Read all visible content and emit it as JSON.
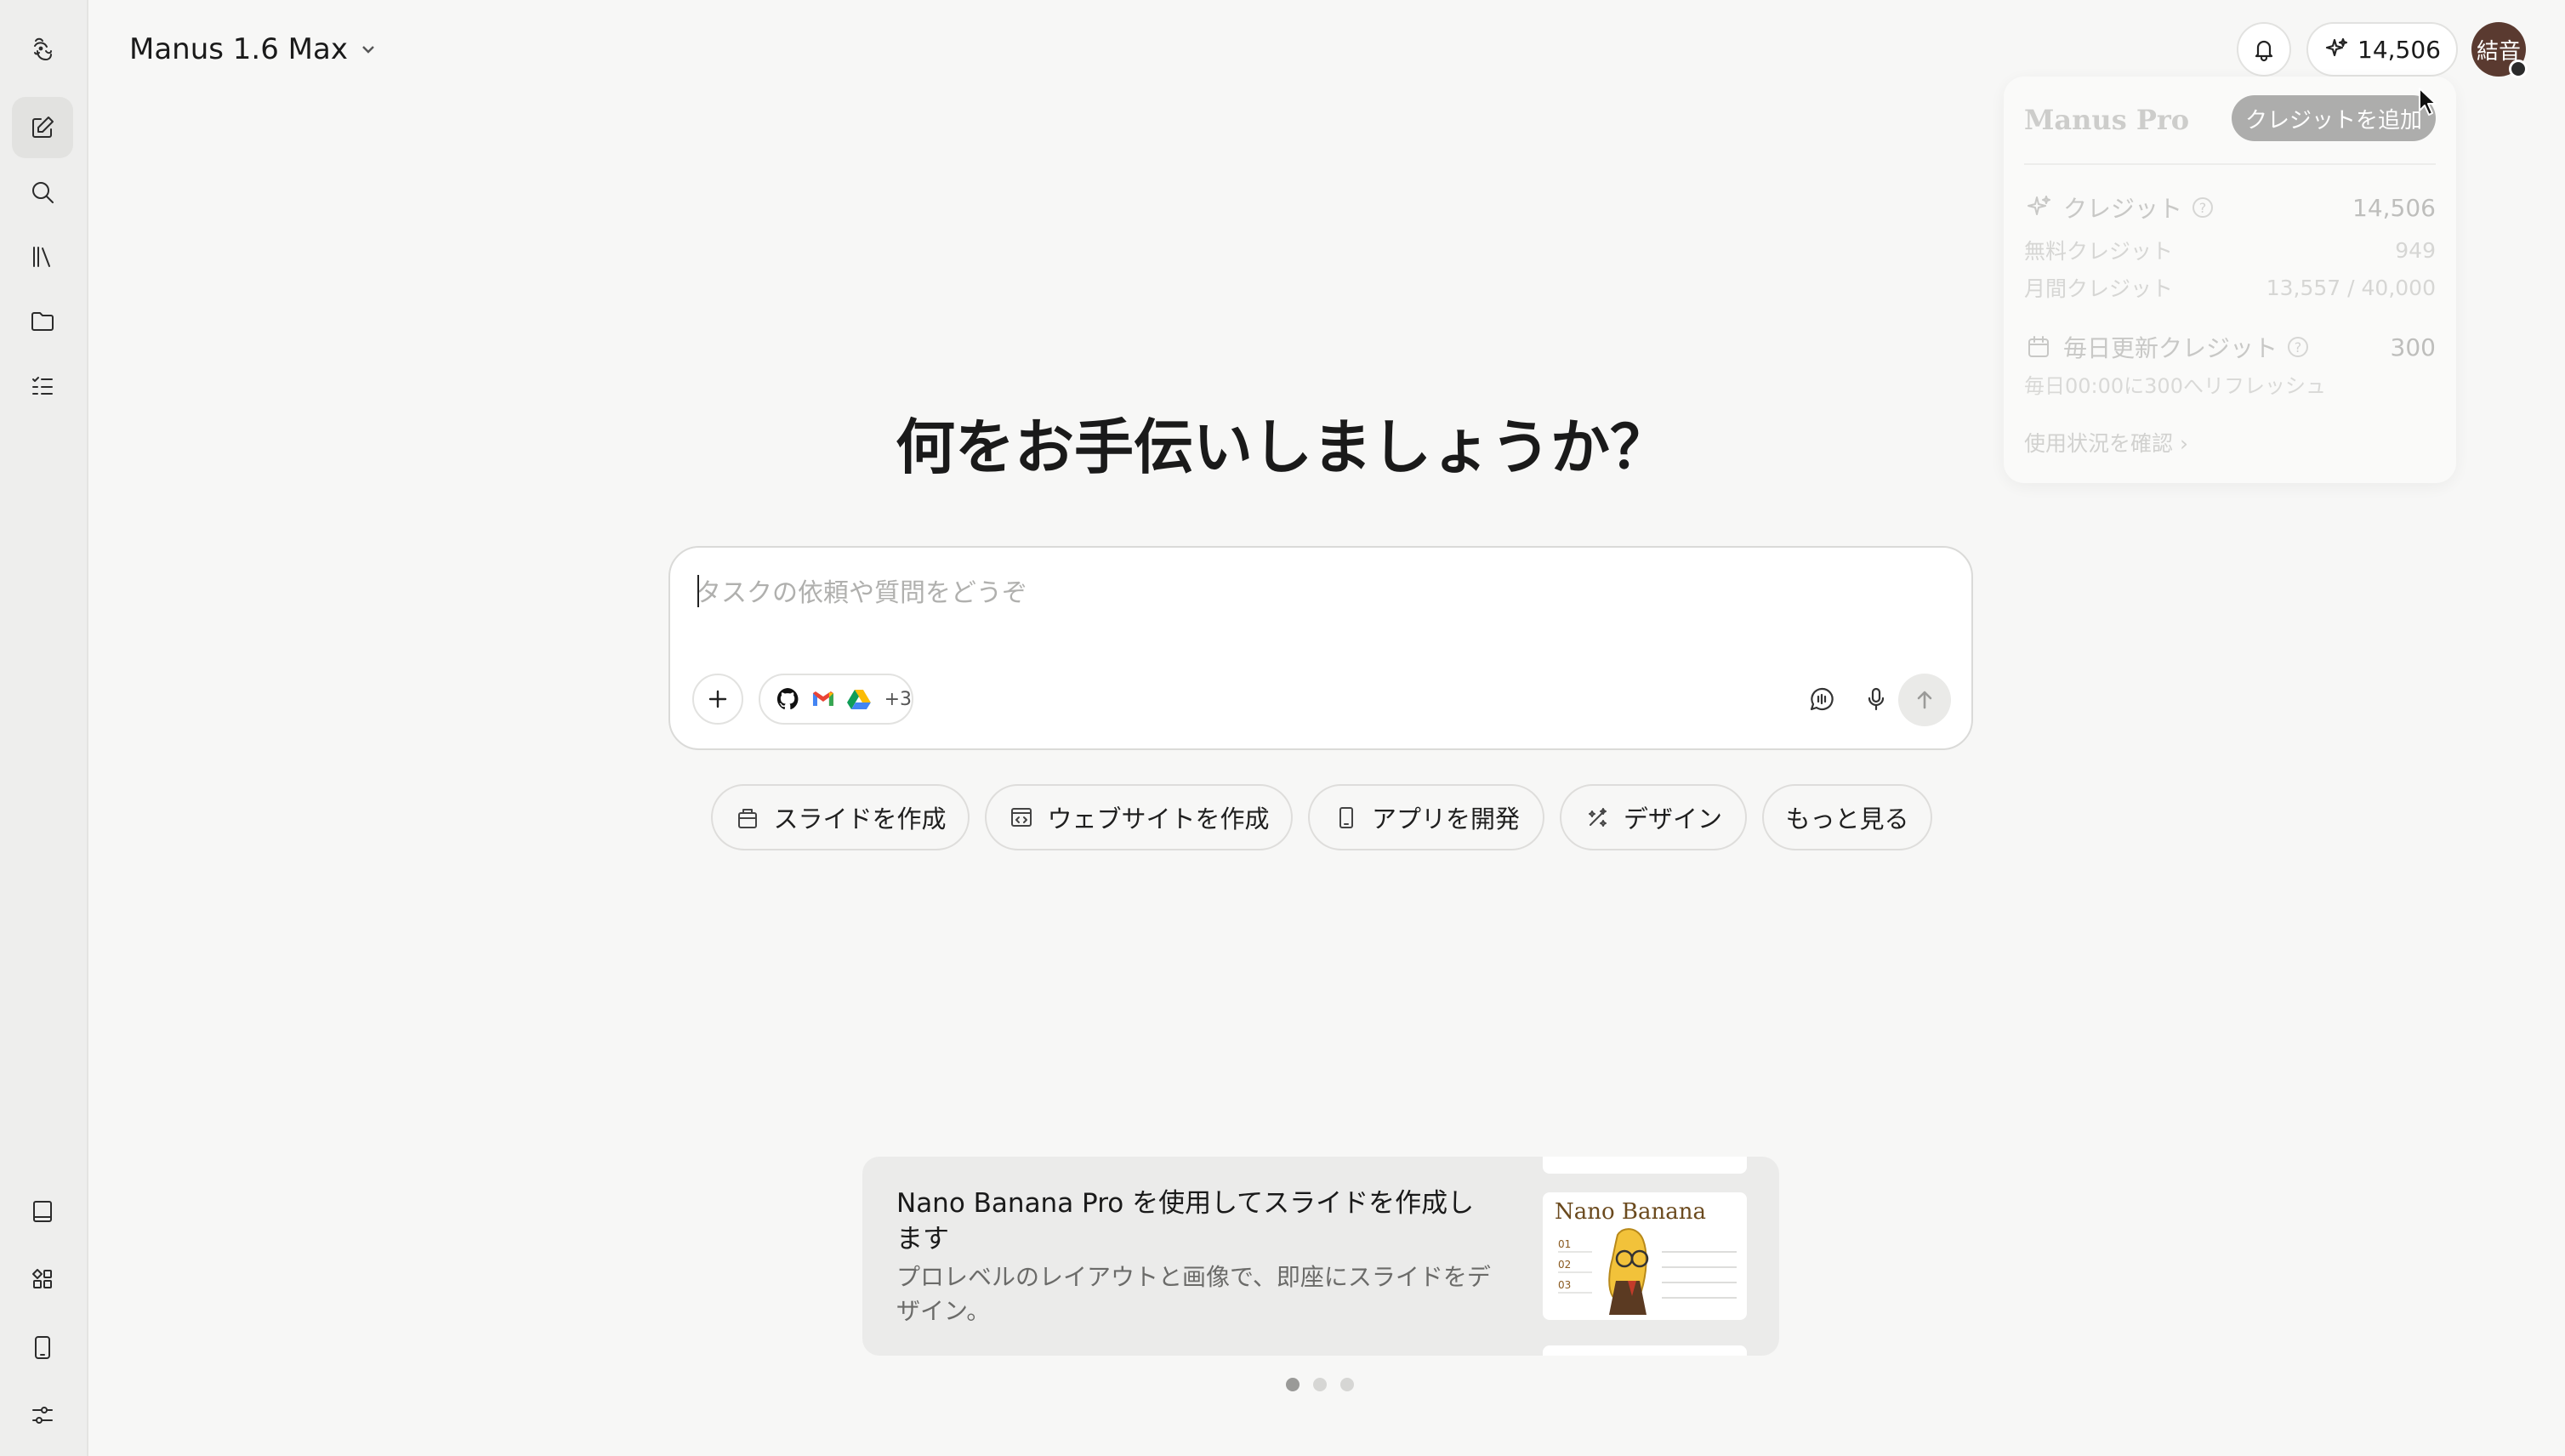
{
  "header": {
    "model_label": "Manus 1.6 Max",
    "credits": "14,506",
    "avatar_text": "結音"
  },
  "sidebar": {
    "top_items": [
      {
        "icon": "manus-logo-icon"
      },
      {
        "icon": "new-task-icon",
        "active": true
      },
      {
        "icon": "search-icon"
      },
      {
        "icon": "library-icon"
      },
      {
        "icon": "folder-icon"
      },
      {
        "icon": "task-list-icon"
      }
    ],
    "bottom_items": [
      {
        "icon": "book-icon"
      },
      {
        "icon": "apps-icon"
      },
      {
        "icon": "mobile-icon"
      },
      {
        "icon": "settings-sliders-icon"
      }
    ]
  },
  "popover": {
    "plan": "Manus Pro",
    "add_credits": "クレジットを追加",
    "credits_label": "クレジット",
    "credits_value": "14,506",
    "free_label": "無料クレジット",
    "free_value": "949",
    "monthly_label": "月間クレジット",
    "monthly_value": "13,557 / 40,000",
    "daily_label": "毎日更新クレジット",
    "daily_value": "300",
    "daily_note": "毎日00:00に300へリフレッシュ",
    "usage_link": "使用状況を確認"
  },
  "main": {
    "title": "何をお手伝いしましょうか？",
    "input_placeholder": "タスクの依頼や質問をどうぞ",
    "connectors_more": "+3"
  },
  "quick_actions": [
    {
      "label": "スライドを作成",
      "icon": "slides-icon"
    },
    {
      "label": "ウェブサイトを作成",
      "icon": "website-icon"
    },
    {
      "label": "アプリを開発",
      "icon": "mobile-app-icon"
    },
    {
      "label": "デザイン",
      "icon": "design-icon"
    },
    {
      "label": "もっと見る",
      "icon": ""
    }
  ],
  "promo": {
    "title": "Nano Banana Pro を使用してスライドを作成します",
    "description": "プロレベルのレイアウトと画像で、即座にスライドをデザイン。",
    "thumb_title": "Nano Banana",
    "thumb_list": [
      "01",
      "02",
      "03"
    ]
  },
  "carousel": {
    "count": 3,
    "active": 0
  },
  "colors": {
    "background": "#f7f7f6",
    "sidebar": "#eeeeed",
    "avatar": "#5a3a30",
    "promo_bg": "#ebebea"
  }
}
